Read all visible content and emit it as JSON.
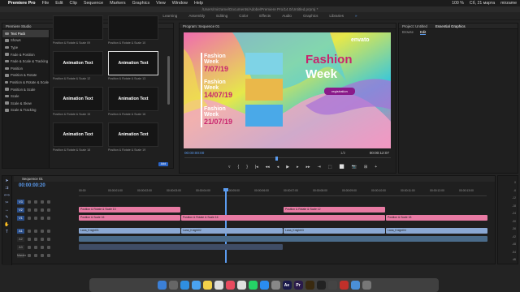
{
  "menubar": {
    "items": [
      "Premiere Pro",
      "File",
      "Edit",
      "Clip",
      "Sequence",
      "Markers",
      "Graphics",
      "View",
      "Window",
      "Help"
    ],
    "right": [
      "100 %",
      "Сб, 21 марта",
      "mirzame"
    ]
  },
  "titlebar": {
    "text": "/Users/mirzame/Documents/Adobe/Premiere Pro/14.0/Untitled.prproj *"
  },
  "workspaces": [
    "Learning",
    "Assembly",
    "Editing",
    "Color",
    "Effects",
    "Audio",
    "Graphics",
    "Libraries",
    "»"
  ],
  "left_panel": {
    "title": "Premiere Studio",
    "tree": [
      "Text Pack",
      "Shows",
      "Type",
      "Fade & Position",
      "Fade & Scale & Tracking",
      "Position",
      "Position & Rotate",
      "Position & Rotate & Scale",
      "Position & Scale",
      "Scale",
      "Scale & Skew",
      "Scale & Tracking"
    ],
    "tiles": [
      {
        "thumb": "",
        "caption": "Position & Rotate & Scale 09"
      },
      {
        "thumb": "",
        "caption": "Position & Rotate & Scale 10"
      },
      {
        "thumb": "Animation Text",
        "caption": "Position & Rotate & Scale 12"
      },
      {
        "thumb": "Animation Text",
        "caption": "Position & Rotate & Scale 13"
      },
      {
        "thumb": "Animation Text",
        "caption": "Position & Rotate & Scale 15"
      },
      {
        "thumb": "Animation Text",
        "caption": "Position & Rotate & Scale 16"
      },
      {
        "thumb": "Animation Text",
        "caption": "Position & Rotate & Scale 18"
      },
      {
        "thumb": "Animation Text",
        "caption": "Position & Rotate & Scale 19"
      }
    ],
    "add": "Add"
  },
  "monitor": {
    "title": "Program: Sequence 01",
    "timecode_left": "00:00:00:00",
    "fit": "1/2",
    "timecode_right": "00:00:12:07",
    "controls": [
      "▿",
      "{",
      "}",
      "|◂",
      "◂◂",
      "◂",
      "▶",
      "▸",
      "▸▸",
      "⇥",
      "⬚",
      "⬜",
      "📷",
      "⊞",
      "+"
    ],
    "video": {
      "brand": "envato",
      "title1": "Fashion",
      "title2": "Week",
      "button": "registration",
      "entries": [
        {
          "label": "Fashion",
          "sub": "Week",
          "date": "7/07/19"
        },
        {
          "label": "Fashion",
          "sub": "Week",
          "date": "14/07/19"
        },
        {
          "label": "Fashion",
          "sub": "Week",
          "date": "21/07/19"
        }
      ]
    }
  },
  "right_panel": {
    "tabs": [
      "Project: Untitled",
      "Essential Graphics"
    ],
    "sub": [
      "Browse",
      "Edit"
    ]
  },
  "timeline": {
    "title": "Sequence 01",
    "timecode": "00:00:00:20",
    "ticks": [
      "00:00",
      "00:00:01:00",
      "00:00:02:00",
      "00:00:03:00",
      "00:00:04:00",
      "00:00:05:00",
      "00:00:06:00",
      "00:00:07:00",
      "00:00:08:00",
      "00:00:09:00",
      "00:00:10:00",
      "00:00:11:00",
      "00:00:12:00",
      "00:00:13:00"
    ],
    "tracks": [
      {
        "name": "V3",
        "on": true
      },
      {
        "name": "V2",
        "on": true
      },
      {
        "name": "V1",
        "on": true
      },
      {
        "name": "A1",
        "on": true
      },
      {
        "name": "A2",
        "on": false
      },
      {
        "name": "A3",
        "on": false
      },
      {
        "name": "Master",
        "on": false
      }
    ],
    "clips": [
      {
        "track": "V2",
        "label": "Position & Rotate & Scale 13",
        "kind": "g",
        "start": 0.0,
        "end": 0.25
      },
      {
        "track": "V2",
        "label": "Position & Rotate & Scale 12",
        "kind": "g",
        "start": 0.5,
        "end": 0.75
      },
      {
        "track": "V1",
        "label": "Position & Scale 16",
        "kind": "g",
        "start": 0.0,
        "end": 0.25
      },
      {
        "track": "V1",
        "label": "Position & Rotate & Scale 16",
        "kind": "g",
        "start": 0.25,
        "end": 0.75
      },
      {
        "track": "V1",
        "label": "Position & Scale 18",
        "kind": "g",
        "start": 0.75,
        "end": 1.0
      },
      {
        "track": "A1",
        "label": "Lana_Knight01",
        "kind": "v",
        "start": 0.0,
        "end": 0.25
      },
      {
        "track": "A1",
        "label": "Lana_Knight02",
        "kind": "v",
        "start": 0.25,
        "end": 0.5
      },
      {
        "track": "A1",
        "label": "Lana_Knight03",
        "kind": "v",
        "start": 0.5,
        "end": 0.75
      },
      {
        "track": "A1",
        "label": "Lana_Knight04",
        "kind": "v",
        "start": 0.75,
        "end": 1.0
      },
      {
        "track": "A2",
        "label": "",
        "kind": "a",
        "start": 0.0,
        "end": 1.0
      },
      {
        "track": "A3",
        "label": "",
        "kind": "d",
        "start": 0.0,
        "end": 0.5
      }
    ],
    "vu_marks": [
      "0",
      "-6",
      "-12",
      "-18",
      "-24",
      "-30",
      "-36",
      "-42",
      "-48",
      "-54",
      "dB"
    ]
  },
  "dock": {
    "apps": [
      {
        "name": "finder",
        "color": "#3b7fd6",
        "glyph": ""
      },
      {
        "name": "launchpad",
        "color": "#666",
        "glyph": ""
      },
      {
        "name": "safari",
        "color": "#2f8fe0",
        "glyph": ""
      },
      {
        "name": "mail",
        "color": "#4aa3f0",
        "glyph": ""
      },
      {
        "name": "notes",
        "color": "#f2d14a",
        "glyph": ""
      },
      {
        "name": "photos",
        "color": "#ddd",
        "glyph": ""
      },
      {
        "name": "music",
        "color": "#e84a5f",
        "glyph": ""
      },
      {
        "name": "chrome",
        "color": "#e0e0e0",
        "glyph": ""
      },
      {
        "name": "whatsapp",
        "color": "#25d366",
        "glyph": ""
      },
      {
        "name": "appstore",
        "color": "#2a8cf0",
        "glyph": ""
      },
      {
        "name": "settings",
        "color": "#888",
        "glyph": ""
      },
      {
        "name": "after-effects",
        "color": "#1a1a4a",
        "glyph": "Ae"
      },
      {
        "name": "premiere",
        "color": "#2a1a4a",
        "glyph": "Pr"
      },
      {
        "name": "illustrator",
        "color": "#3a2a10",
        "glyph": ""
      },
      {
        "name": "terminal",
        "color": "#222",
        "glyph": ""
      },
      {
        "name": "activity",
        "color": "#444",
        "glyph": ""
      },
      {
        "name": "red-app",
        "color": "#c0302a",
        "glyph": ""
      },
      {
        "name": "folder",
        "color": "#4a8fd8",
        "glyph": ""
      },
      {
        "name": "trash",
        "color": "#777",
        "glyph": ""
      }
    ]
  }
}
